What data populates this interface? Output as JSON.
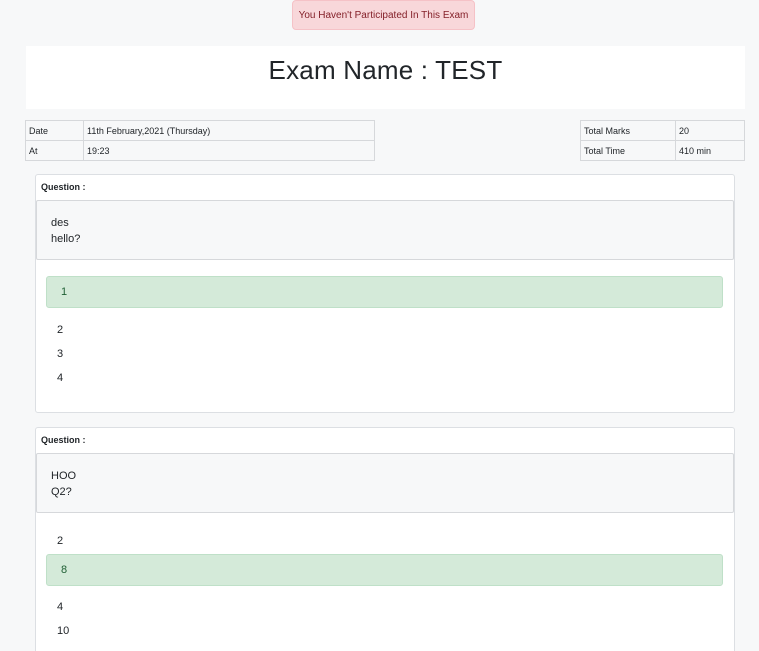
{
  "alert": {
    "text": "You Haven't Participated In This Exam"
  },
  "exam": {
    "title": "Exam Name : TEST"
  },
  "info_left": [
    {
      "label": "Date",
      "value": "11th February,2021 (Thursday)"
    },
    {
      "label": "At",
      "value": "19:23"
    }
  ],
  "info_right": [
    {
      "label": "Total Marks",
      "value": "20"
    },
    {
      "label": "Total Time",
      "value": "410 min"
    }
  ],
  "questions": [
    {
      "label": "Question :",
      "text_lines": [
        "des",
        "hello?"
      ],
      "options": [
        "1",
        "2",
        "3",
        "4"
      ],
      "correct_index": 0
    },
    {
      "label": "Question :",
      "text_lines": [
        "HOO",
        "Q2?"
      ],
      "options": [
        "2",
        "8",
        "4",
        "10"
      ],
      "correct_index": 1
    }
  ]
}
